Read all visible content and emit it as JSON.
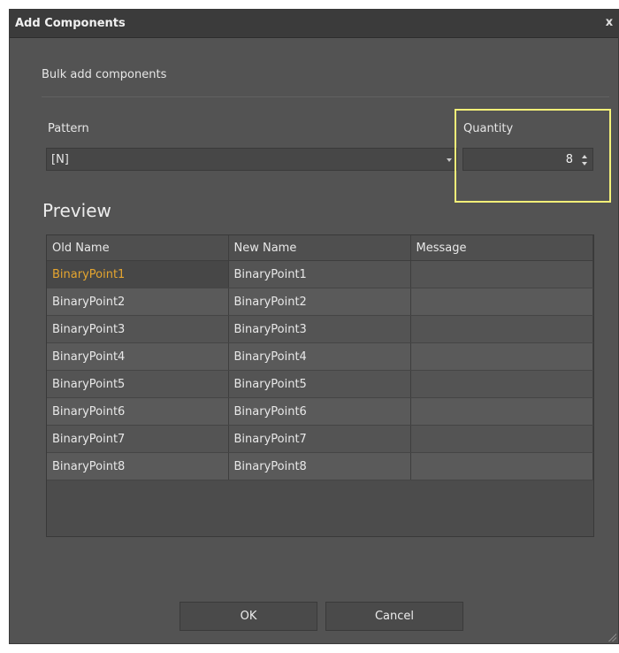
{
  "dialog": {
    "title": "Add Components",
    "close_label": "x",
    "subtitle": "Bulk add components"
  },
  "form": {
    "pattern_label": "Pattern",
    "pattern_value": "[N]",
    "quantity_label": "Quantity",
    "quantity_value": "8"
  },
  "preview": {
    "heading": "Preview",
    "columns": [
      "Old Name",
      "New Name",
      "Message"
    ],
    "rows": [
      {
        "old": "BinaryPoint1",
        "new": "BinaryPoint1",
        "message": ""
      },
      {
        "old": "BinaryPoint2",
        "new": "BinaryPoint2",
        "message": ""
      },
      {
        "old": "BinaryPoint3",
        "new": "BinaryPoint3",
        "message": ""
      },
      {
        "old": "BinaryPoint4",
        "new": "BinaryPoint4",
        "message": ""
      },
      {
        "old": "BinaryPoint5",
        "new": "BinaryPoint5",
        "message": ""
      },
      {
        "old": "BinaryPoint6",
        "new": "BinaryPoint6",
        "message": ""
      },
      {
        "old": "BinaryPoint7",
        "new": "BinaryPoint7",
        "message": ""
      },
      {
        "old": "BinaryPoint8",
        "new": "BinaryPoint8",
        "message": ""
      }
    ]
  },
  "buttons": {
    "ok_label": "OK",
    "cancel_label": "Cancel"
  },
  "colors": {
    "dialog_bg": "#535353",
    "titlebar_bg": "#3b3b3b",
    "selected_text": "#e5a52f",
    "highlight_border": "#f4f078"
  },
  "icons": {
    "close": "close-icon",
    "dropdown": "chevron-down-icon",
    "spin": "spin-up-down-icon",
    "resize": "resize-grip-icon"
  }
}
